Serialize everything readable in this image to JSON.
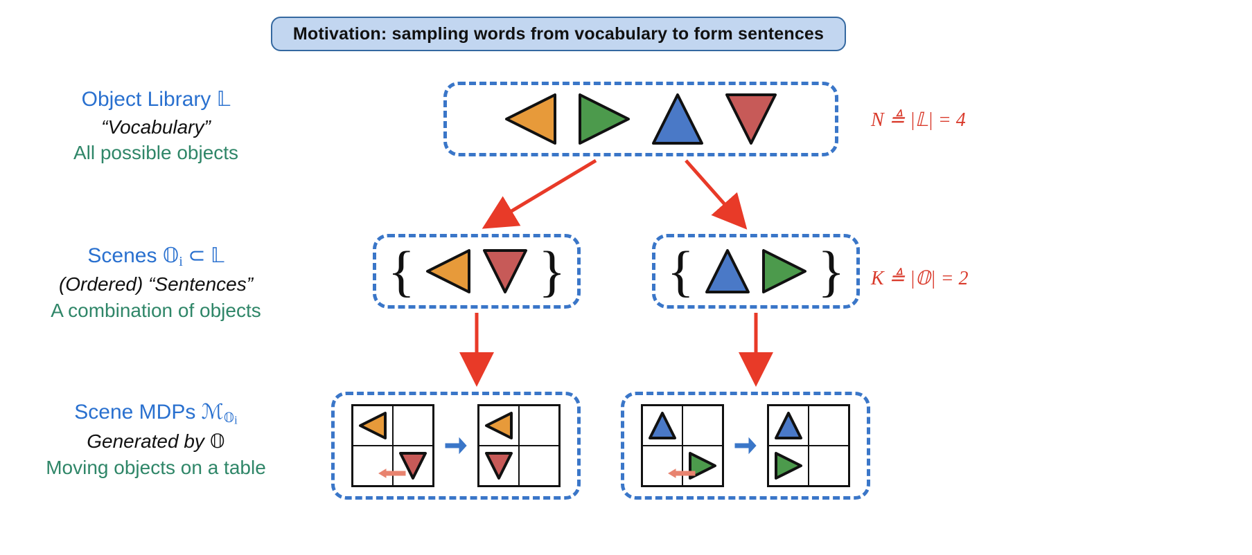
{
  "banner": {
    "text": "Motivation: sampling words from vocabulary to form sentences"
  },
  "rows": {
    "library": {
      "title_prefix": "Object Library ",
      "title_symbol": "𝕃",
      "subtitle": "“Vocabulary”",
      "desc": "All possible objects"
    },
    "scenes": {
      "title_prefix": "Scenes ",
      "title_symbol": "𝕆",
      "title_sub": "i",
      "title_rel": " ⊂ 𝕃",
      "subtitle": "(Ordered) “Sentences”",
      "desc": "A combination of objects"
    },
    "mdps": {
      "title_prefix": "Scene MDPs ",
      "title_symbol_script": "ℳ",
      "title_sub_symbol": "𝕆",
      "title_sub_sub": "i",
      "subtitle_prefix": "Generated by ",
      "subtitle_symbol": "𝕆",
      "desc": "Moving objects on a table"
    }
  },
  "equations": {
    "library": "N ≜ |𝕃| = 4",
    "scenes": "K ≜ |𝕆| = 2"
  },
  "triangles": {
    "library": [
      {
        "dir": "left",
        "fill": "#e79a3a"
      },
      {
        "dir": "right",
        "fill": "#4c9a4c"
      },
      {
        "dir": "up",
        "fill": "#4a79c7"
      },
      {
        "dir": "down",
        "fill": "#c75a58"
      }
    ],
    "scene_a": [
      {
        "dir": "left",
        "fill": "#e79a3a"
      },
      {
        "dir": "down",
        "fill": "#c75a58"
      }
    ],
    "scene_b": [
      {
        "dir": "up",
        "fill": "#4a79c7"
      },
      {
        "dir": "right",
        "fill": "#4c9a4c"
      }
    ]
  },
  "mdp": {
    "a": {
      "before": {
        "tl": {
          "dir": "left",
          "fill": "#e79a3a"
        },
        "br": {
          "dir": "down",
          "fill": "#c75a58"
        }
      },
      "after": {
        "tl": {
          "dir": "left",
          "fill": "#e79a3a"
        },
        "bl": {
          "dir": "down",
          "fill": "#c75a58"
        }
      },
      "action_arrow": {
        "dir": "left",
        "fill": "#e8836f"
      }
    },
    "b": {
      "before": {
        "tl": {
          "dir": "up",
          "fill": "#4a79c7"
        },
        "br": {
          "dir": "right",
          "fill": "#4c9a4c"
        }
      },
      "after": {
        "tl": {
          "dir": "up",
          "fill": "#4a79c7"
        },
        "bl": {
          "dir": "right",
          "fill": "#4c9a4c"
        }
      },
      "action_arrow": {
        "dir": "left",
        "fill": "#e8836f"
      }
    },
    "transition_arrow": {
      "dir": "right",
      "fill": "#3a76c8"
    }
  }
}
